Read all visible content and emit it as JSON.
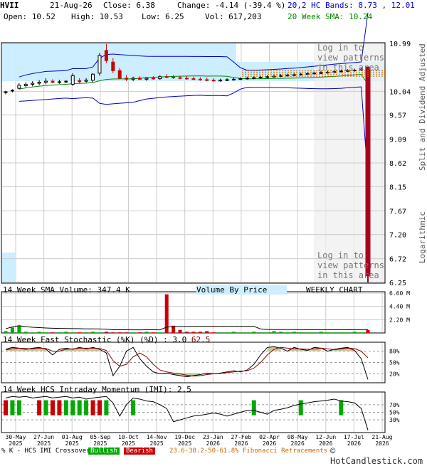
{
  "header": {
    "symbol": "HVII",
    "date": "21-Aug-26",
    "close": "Close: 6.38",
    "change": "Change: -4.14 (-39.4 %)",
    "open": "Open: 10.52",
    "high": "High: 10.53",
    "low": "Low: 6.25",
    "vol": "Vol: 617,203",
    "bands": "20,2 HC Bands: 8.73 , 12.01",
    "sma": "20 Week SMA: 10.24"
  },
  "colors": {
    "bg_band": "#cceeff",
    "grid": "#cccccc",
    "up": "#00aa00",
    "down": "#cc0000",
    "sma_line": "#008800",
    "band_line": "#0000cc",
    "stoch_k": "#000000",
    "stoch_d": "#880000",
    "bearish_red": "#aa0022",
    "fib": "#cc6600",
    "olive_fill": "#bbbb88"
  },
  "overlays": {
    "login_top": "Log in to view patterns in this area",
    "login_bottom": "Log in to view patterns in this area",
    "split_label": "Split and Dividend Adjusted",
    "log_label": "Logarithmic"
  },
  "chart_data": [
    {
      "type": "candlestick",
      "panel": "price",
      "ylim": [
        6.25,
        10.99
      ],
      "yticks": [
        "10.99",
        "10.04",
        "9.57",
        "9.09",
        "8.62",
        "8.15",
        "7.67",
        "7.20",
        "6.72",
        "6.25"
      ],
      "candles": [
        {
          "o": 10.02,
          "h": 10.05,
          "l": 9.98,
          "c": 10.03
        },
        {
          "o": 10.05,
          "h": 10.08,
          "l": 10.02,
          "c": 10.06
        },
        {
          "o": 10.1,
          "h": 10.2,
          "l": 10.08,
          "c": 10.16
        },
        {
          "o": 10.15,
          "h": 10.22,
          "l": 10.12,
          "c": 10.18
        },
        {
          "o": 10.18,
          "h": 10.24,
          "l": 10.14,
          "c": 10.2
        },
        {
          "o": 10.2,
          "h": 10.26,
          "l": 10.16,
          "c": 10.22
        },
        {
          "o": 10.22,
          "h": 10.3,
          "l": 10.18,
          "c": 10.24
        },
        {
          "o": 10.24,
          "h": 10.28,
          "l": 10.2,
          "c": 10.22
        },
        {
          "o": 10.22,
          "h": 10.27,
          "l": 10.19,
          "c": 10.23
        },
        {
          "o": 10.23,
          "h": 10.26,
          "l": 10.2,
          "c": 10.24
        },
        {
          "o": 10.18,
          "h": 10.4,
          "l": 10.15,
          "c": 10.35
        },
        {
          "o": 10.25,
          "h": 10.3,
          "l": 10.2,
          "c": 10.23
        },
        {
          "o": 10.24,
          "h": 10.3,
          "l": 10.21,
          "c": 10.26
        },
        {
          "o": 10.26,
          "h": 10.4,
          "l": 10.22,
          "c": 10.38
        },
        {
          "o": 10.4,
          "h": 10.8,
          "l": 10.35,
          "c": 10.75
        },
        {
          "o": 10.85,
          "h": 10.98,
          "l": 10.6,
          "c": 10.65
        },
        {
          "o": 10.62,
          "h": 10.7,
          "l": 10.4,
          "c": 10.45
        },
        {
          "o": 10.45,
          "h": 10.5,
          "l": 10.28,
          "c": 10.3
        },
        {
          "o": 10.3,
          "h": 10.36,
          "l": 10.24,
          "c": 10.28
        },
        {
          "o": 10.28,
          "h": 10.33,
          "l": 10.24,
          "c": 10.3
        },
        {
          "o": 10.3,
          "h": 10.34,
          "l": 10.26,
          "c": 10.28
        },
        {
          "o": 10.28,
          "h": 10.32,
          "l": 10.25,
          "c": 10.3
        },
        {
          "o": 10.3,
          "h": 10.34,
          "l": 10.27,
          "c": 10.29
        },
        {
          "o": 10.29,
          "h": 10.36,
          "l": 10.27,
          "c": 10.33
        },
        {
          "o": 10.33,
          "h": 10.38,
          "l": 10.3,
          "c": 10.32
        },
        {
          "o": 10.32,
          "h": 10.36,
          "l": 10.29,
          "c": 10.31
        },
        {
          "o": 10.31,
          "h": 10.35,
          "l": 10.28,
          "c": 10.3
        },
        {
          "o": 10.3,
          "h": 10.34,
          "l": 10.27,
          "c": 10.29
        },
        {
          "o": 10.29,
          "h": 10.33,
          "l": 10.26,
          "c": 10.28
        },
        {
          "o": 10.28,
          "h": 10.32,
          "l": 10.25,
          "c": 10.27
        },
        {
          "o": 10.27,
          "h": 10.31,
          "l": 10.24,
          "c": 10.26
        },
        {
          "o": 10.26,
          "h": 10.3,
          "l": 10.23,
          "c": 10.25
        },
        {
          "o": 10.25,
          "h": 10.29,
          "l": 10.23,
          "c": 10.26
        },
        {
          "o": 10.26,
          "h": 10.3,
          "l": 10.24,
          "c": 10.27
        },
        {
          "o": 10.27,
          "h": 10.31,
          "l": 10.25,
          "c": 10.28
        },
        {
          "o": 10.28,
          "h": 10.32,
          "l": 10.26,
          "c": 10.29
        },
        {
          "o": 10.29,
          "h": 10.33,
          "l": 10.27,
          "c": 10.3
        },
        {
          "o": 10.3,
          "h": 10.34,
          "l": 10.28,
          "c": 10.31
        },
        {
          "o": 10.31,
          "h": 10.35,
          "l": 10.29,
          "c": 10.32
        },
        {
          "o": 10.32,
          "h": 10.36,
          "l": 10.3,
          "c": 10.33
        },
        {
          "o": 10.33,
          "h": 10.37,
          "l": 10.31,
          "c": 10.34
        },
        {
          "o": 10.34,
          "h": 10.38,
          "l": 10.32,
          "c": 10.35
        },
        {
          "o": 10.35,
          "h": 10.39,
          "l": 10.33,
          "c": 10.36
        },
        {
          "o": 10.36,
          "h": 10.4,
          "l": 10.34,
          "c": 10.37
        },
        {
          "o": 10.37,
          "h": 10.41,
          "l": 10.35,
          "c": 10.38
        },
        {
          "o": 10.38,
          "h": 10.42,
          "l": 10.36,
          "c": 10.39
        },
        {
          "o": 10.39,
          "h": 10.43,
          "l": 10.37,
          "c": 10.4
        },
        {
          "o": 10.4,
          "h": 10.44,
          "l": 10.38,
          "c": 10.41
        },
        {
          "o": 10.41,
          "h": 10.45,
          "l": 10.39,
          "c": 10.42
        },
        {
          "o": 10.42,
          "h": 10.46,
          "l": 10.4,
          "c": 10.43
        },
        {
          "o": 10.43,
          "h": 10.47,
          "l": 10.41,
          "c": 10.44
        },
        {
          "o": 10.44,
          "h": 10.48,
          "l": 10.42,
          "c": 10.45
        },
        {
          "o": 10.45,
          "h": 10.49,
          "l": 10.43,
          "c": 10.46
        },
        {
          "o": 10.46,
          "h": 10.5,
          "l": 10.44,
          "c": 10.48
        },
        {
          "o": 10.52,
          "h": 10.53,
          "l": 6.25,
          "c": 6.38
        }
      ]
    },
    {
      "type": "bar",
      "panel": "volume",
      "title": "14 Week SMA Volume: 347.4 K",
      "ylim": [
        0,
        6.6
      ],
      "yticks": [
        "6.60 M",
        "4.40 M",
        "2.20 M"
      ],
      "values": [
        0.3,
        0.9,
        1.2,
        0.2,
        0.1,
        0.2,
        0.1,
        0.1,
        0.1,
        0.2,
        0.1,
        0.1,
        0.1,
        0.2,
        0.1,
        0.2,
        0.1,
        0.1,
        0.1,
        0.1,
        0.1,
        0.2,
        0.1,
        0.1,
        6.4,
        1.2,
        0.5,
        0.2,
        0.2,
        0.2,
        0.3,
        0.1,
        0.1,
        0.1,
        0.2,
        0.1,
        0.1,
        0.2,
        0.1,
        0.1,
        0.3,
        0.2,
        0.1,
        0.2,
        0.1,
        0.1,
        0.1,
        0.2,
        0.1,
        0.1,
        0.1,
        0.1,
        0.2,
        0.1,
        0.5
      ]
    },
    {
      "type": "line",
      "panel": "stochastic",
      "title": "14 Week Fast Stochastic (%K)",
      "title_d": "(%D) : 3.0",
      "value_d": "62.5",
      "ylim": [
        0,
        100
      ],
      "yticks": [
        "80%",
        "50%",
        "20%"
      ],
      "k": [
        85,
        90,
        88,
        85,
        88,
        90,
        85,
        70,
        85,
        88,
        85,
        90,
        86,
        90,
        85,
        75,
        15,
        40,
        80,
        90,
        60,
        40,
        25,
        20,
        22,
        18,
        15,
        12,
        15,
        18,
        22,
        20,
        22,
        25,
        28,
        25,
        30,
        45,
        70,
        90,
        92,
        88,
        80,
        90,
        85,
        82,
        90,
        88,
        80,
        85,
        88,
        90,
        82,
        60,
        5
      ],
      "d": [
        84,
        86,
        88,
        87,
        86,
        88,
        87,
        80,
        80,
        85,
        86,
        88,
        88,
        88,
        87,
        82,
        55,
        40,
        45,
        65,
        75,
        65,
        45,
        30,
        25,
        22,
        20,
        16,
        14,
        15,
        18,
        20,
        21,
        23,
        25,
        27,
        28,
        35,
        50,
        70,
        85,
        90,
        88,
        86,
        86,
        85,
        86,
        88,
        86,
        84,
        86,
        88,
        87,
        80,
        62.5
      ]
    },
    {
      "type": "line",
      "panel": "momentum",
      "title": "14 Week HCS Intraday Momentum (IMI): 2.5",
      "ylim": [
        0,
        100
      ],
      "yticks": [
        "70%",
        "50%",
        "30%"
      ],
      "values": [
        88,
        92,
        90,
        92,
        88,
        90,
        92,
        88,
        90,
        92,
        88,
        90,
        85,
        88,
        90,
        92,
        75,
        40,
        70,
        88,
        85,
        80,
        78,
        70,
        60,
        25,
        30,
        35,
        40,
        42,
        45,
        48,
        45,
        40,
        45,
        50,
        55,
        55,
        50,
        45,
        55,
        58,
        62,
        68,
        72,
        75,
        78,
        80,
        82,
        85,
        80,
        78,
        75,
        60,
        2.5
      ],
      "bull_bars": [
        1,
        2,
        6,
        9,
        10,
        11,
        12,
        15,
        19,
        37,
        44,
        50
      ],
      "bear_bars": [
        0,
        5,
        7,
        8,
        13,
        14
      ]
    }
  ],
  "xaxis": {
    "labels": [
      "30-May\n2025",
      "27-Jun\n2025",
      "01-Aug\n2025",
      "05-Sep\n2025",
      "10-Oct\n2025",
      "14-Nov\n2025",
      "19-Dec\n2025",
      "23-Jan\n2026",
      "27-Feb\n2026",
      "02-Apr\n2026",
      "08-May\n2026",
      "12-Jun\n2026",
      "17-Jul\n2026",
      "21-Aug\n2026"
    ]
  },
  "volume_extra": {
    "vbp": "Volume By Price",
    "weekly": "WEEKLY CHART"
  },
  "footer": {
    "legend_prefix": "% K - HCS IMI Crossover:",
    "bullish": "Bullish",
    "bearish": "Bearish",
    "fib": "23.6-38.2-50-61.8% Fibonacci Retracements",
    "brand": "© HotCandlestick.com"
  }
}
